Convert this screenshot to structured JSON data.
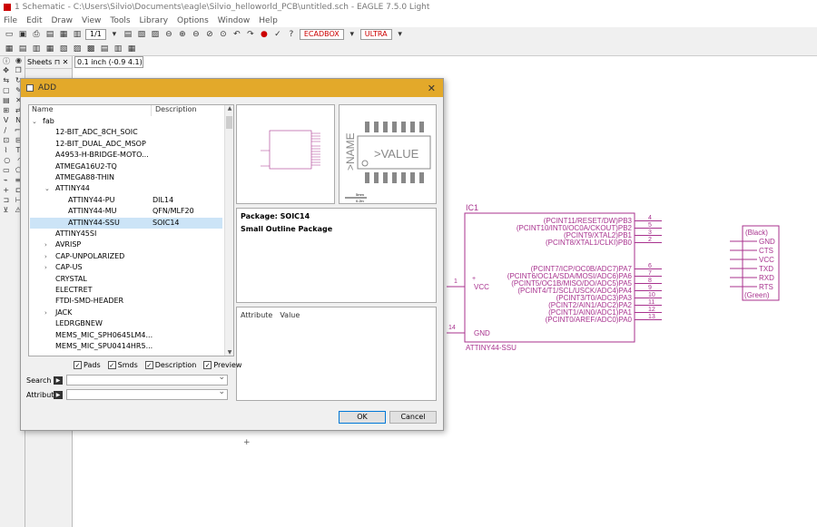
{
  "window": {
    "title": "1 Schematic - C:\\Users\\Silvio\\Documents\\eagle\\Silvio_helloworld_PCB\\untitled.sch - EAGLE 7.5.0 Light"
  },
  "menu": [
    "File",
    "Edit",
    "Draw",
    "View",
    "Tools",
    "Library",
    "Options",
    "Window",
    "Help"
  ],
  "toolbar": {
    "sheet_select": "1/1",
    "device_label_1": "ECADBOX",
    "device_label_2": "ULTRA"
  },
  "sheets": {
    "label": "Sheets",
    "coord": "0.1 inch (-0.9 4.1)"
  },
  "dialog": {
    "title": "ADD",
    "col_name": "Name",
    "col_desc": "Description",
    "tree": [
      {
        "name": "fab",
        "desc": "",
        "level": 0,
        "expander": "⌄"
      },
      {
        "name": "12-BIT_ADC_8CH_SOIC",
        "desc": "",
        "level": 1,
        "expander": ""
      },
      {
        "name": "12-BIT_DUAL_ADC_MSOP",
        "desc": "",
        "level": 1,
        "expander": ""
      },
      {
        "name": "A4953-H-BRIDGE-MOTO...",
        "desc": "",
        "level": 1,
        "expander": ""
      },
      {
        "name": "ATMEGA16U2-TQ",
        "desc": "",
        "level": 1,
        "expander": ""
      },
      {
        "name": "ATMEGA88-THIN",
        "desc": "",
        "level": 1,
        "expander": ""
      },
      {
        "name": "ATTINY44",
        "desc": "",
        "level": 1,
        "expander": "⌄"
      },
      {
        "name": "ATTINY44-PU",
        "desc": "DIL14",
        "level": 2,
        "expander": ""
      },
      {
        "name": "ATTINY44-MU",
        "desc": "QFN/MLF20",
        "level": 2,
        "expander": ""
      },
      {
        "name": "ATTINY44-SSU",
        "desc": "SOIC14",
        "level": 2,
        "expander": "",
        "selected": true
      },
      {
        "name": "ATTINY45SI",
        "desc": "",
        "level": 1,
        "expander": ""
      },
      {
        "name": "AVRISP",
        "desc": "",
        "level": 1,
        "expander": "›"
      },
      {
        "name": "CAP-UNPOLARIZED",
        "desc": "",
        "level": 1,
        "expander": "›"
      },
      {
        "name": "CAP-US",
        "desc": "",
        "level": 1,
        "expander": "›"
      },
      {
        "name": "CRYSTAL",
        "desc": "",
        "level": 1,
        "expander": ""
      },
      {
        "name": "ELECTRET",
        "desc": "",
        "level": 1,
        "expander": ""
      },
      {
        "name": "FTDI-SMD-HEADER",
        "desc": "",
        "level": 1,
        "expander": ""
      },
      {
        "name": "JACK",
        "desc": "",
        "level": 1,
        "expander": "›"
      },
      {
        "name": "LEDRGBNEW",
        "desc": "",
        "level": 1,
        "expander": ""
      },
      {
        "name": "MEMS_MIC_SPH0645LM4...",
        "desc": "",
        "level": 1,
        "expander": ""
      },
      {
        "name": "MEMS_MIC_SPU0414HR5...",
        "desc": "",
        "level": 1,
        "expander": ""
      }
    ],
    "package_label": "Package: SOIC14",
    "package_desc": "Small Outline Package",
    "attr_col1": "Attribute",
    "attr_col2": "Value",
    "checks": [
      {
        "label": "Pads",
        "checked": true
      },
      {
        "label": "Smds",
        "checked": true
      },
      {
        "label": "Description",
        "checked": true
      },
      {
        "label": "Preview",
        "checked": true
      }
    ],
    "search_label": "Search",
    "attributes_label": "Attributes",
    "ok": "OK",
    "cancel": "Cancel",
    "pkg_name": ">NAME",
    "pkg_value": ">VALUE",
    "pkg_scale_1": "5mm",
    "pkg_scale_2": "0.2in"
  },
  "schematic": {
    "ic_name": "IC1",
    "ic_part": "ATTINY44-SSU",
    "pins_right": [
      {
        "label": "(PCINT11/RESET/DW)PB3",
        "num": "4"
      },
      {
        "label": "(PCINT10/INT0/OC0A/CKOUT)PB2",
        "num": "5"
      },
      {
        "label": "(PCINT9/XTAL2)PB1",
        "num": "3"
      },
      {
        "label": "(PCINT8/XTAL1/CLKI)PB0",
        "num": "2"
      },
      {
        "label": "(PCINT7/ICP/OC0B/ADC7)PA7",
        "num": "6"
      },
      {
        "label": "(PCINT6/OC1A/SDA/MOSI/ADC6)PA6",
        "num": "7"
      },
      {
        "label": "(PCINT5/OC1B/MISO/DO/ADC5)PA5",
        "num": "8"
      },
      {
        "label": "(PCINT4/T1/SCL/USCK/ADC4)PA4",
        "num": "9"
      },
      {
        "label": "(PCINT3/T0/ADC3)PA3",
        "num": "10"
      },
      {
        "label": "(PCINT2/AIN1/ADC2)PA2",
        "num": "11"
      },
      {
        "label": "(PCINT1/AIN0/ADC1)PA1",
        "num": "12"
      },
      {
        "label": "(PCINT0/AREF/ADC0)PA0",
        "num": "13"
      }
    ],
    "pin_vcc": "VCC",
    "pin_gnd": "GND",
    "pin_vcc_num": "1",
    "pin_gnd_num": "14",
    "ftdi_top": "(Black)",
    "ftdi_bottom": "(Green)",
    "ftdi_pins": [
      "GND",
      "CTS",
      "VCC",
      "TXD",
      "RXD",
      "RTS"
    ]
  }
}
